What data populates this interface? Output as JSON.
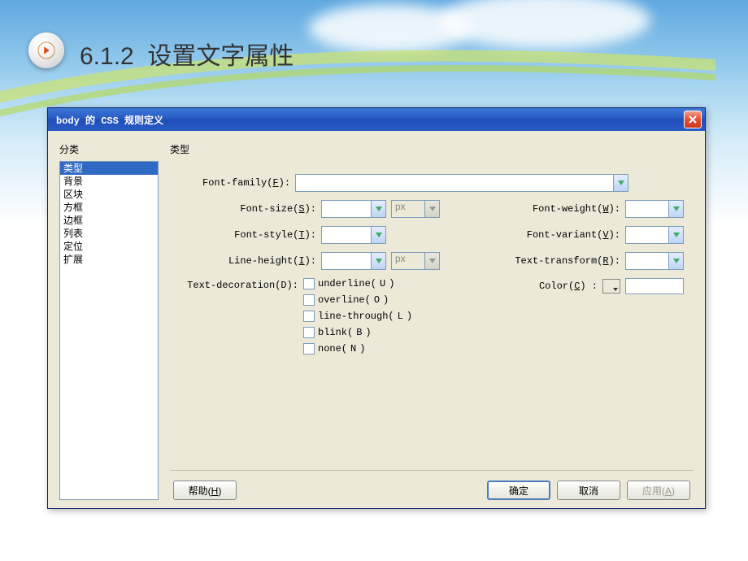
{
  "page": {
    "section_number": "6.1.2",
    "title": "设置文字属性"
  },
  "dialog": {
    "title": "body 的 CSS 规则定义"
  },
  "sidebar": {
    "label": "分类",
    "items": [
      "类型",
      "背景",
      "区块",
      "方框",
      "边框",
      "列表",
      "定位",
      "扩展"
    ],
    "selected_index": 0
  },
  "section": {
    "label": "类型"
  },
  "fields": {
    "font_family": {
      "label": "Font-family(",
      "hotkey": "F",
      "label_end": "):"
    },
    "font_size": {
      "label": "Font-size(",
      "hotkey": "S",
      "label_end": "):",
      "unit": "px"
    },
    "font_weight": {
      "label": "Font-weight(",
      "hotkey": "W",
      "label_end": "):"
    },
    "font_style": {
      "label": "Font-style(",
      "hotkey": "T",
      "label_end": "):"
    },
    "font_variant": {
      "label": "Font-variant(",
      "hotkey": "V",
      "label_end": "):"
    },
    "line_height": {
      "label": "Line-height(",
      "hotkey": "I",
      "label_end": "):",
      "unit": "px"
    },
    "text_transform": {
      "label": "Text-transform(",
      "hotkey": "R",
      "label_end": "):"
    },
    "text_decoration": {
      "label": "Text-decoration(",
      "hotkey": "D",
      "label_end": "):"
    },
    "color": {
      "label": "Color(",
      "hotkey": "C",
      "label_end": ") :"
    }
  },
  "decorations": {
    "underline": {
      "label": "underline(",
      "hotkey": "U",
      "label_end": ")"
    },
    "overline": {
      "label": "overline(",
      "hotkey": "O",
      "label_end": ")"
    },
    "line_through": {
      "label": "line-through(",
      "hotkey": "L",
      "label_end": ")"
    },
    "blink": {
      "label": "blink(",
      "hotkey": "B",
      "label_end": ")"
    },
    "none": {
      "label": "none(",
      "hotkey": "N",
      "label_end": ")"
    }
  },
  "buttons": {
    "help": {
      "label": "帮助(",
      "hotkey": "H",
      "label_end": ")"
    },
    "ok": "确定",
    "cancel": "取消",
    "apply": {
      "label": "应用(",
      "hotkey": "A",
      "label_end": ")"
    }
  }
}
